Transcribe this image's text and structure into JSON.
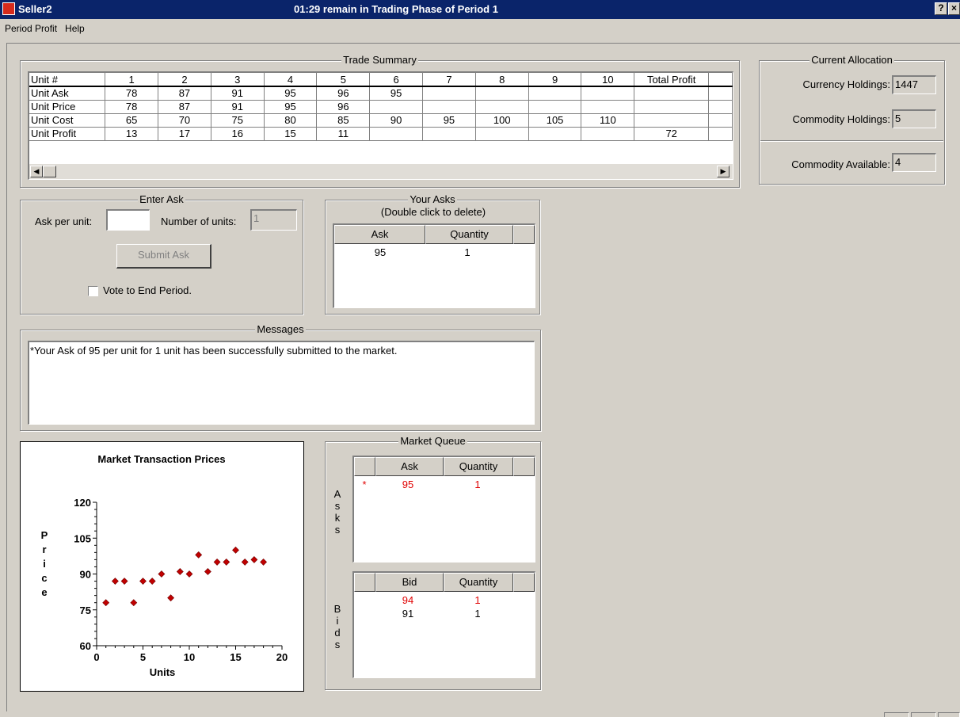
{
  "window": {
    "app_title": "Seller2",
    "caption": "01:29 remain in Trading Phase of Period 1",
    "help_btn": "?",
    "close_btn": "×"
  },
  "menu": [
    "Period Profit",
    "Help"
  ],
  "trade_summary": {
    "title": "Trade Summary",
    "header": [
      "Unit #",
      "1",
      "2",
      "3",
      "4",
      "5",
      "6",
      "7",
      "8",
      "9",
      "10",
      "Total Profit",
      ""
    ],
    "rows": [
      [
        "Unit Ask",
        "78",
        "87",
        "91",
        "95",
        "96",
        "95",
        "",
        "",
        "",
        "",
        "",
        ""
      ],
      [
        "Unit Price",
        "78",
        "87",
        "91",
        "95",
        "96",
        "",
        "",
        "",
        "",
        "",
        "",
        ""
      ],
      [
        "Unit Cost",
        "65",
        "70",
        "75",
        "80",
        "85",
        "90",
        "95",
        "100",
        "105",
        "110",
        "",
        ""
      ],
      [
        "Unit Profit",
        "13",
        "17",
        "16",
        "15",
        "11",
        "",
        "",
        "",
        "",
        "",
        "72",
        ""
      ]
    ]
  },
  "current_allocation": {
    "title": "Current Allocation",
    "currency_label": "Currency Holdings:",
    "currency_value": "1447",
    "commodity_label": "Commodity Holdings:",
    "commodity_value": "5",
    "available_label": "Commodity Available:",
    "available_value": "4"
  },
  "enter_ask": {
    "title": "Enter Ask",
    "ask_label": "Ask per unit:",
    "ask_value": "",
    "units_label": "Number of units:",
    "units_value": "1",
    "submit_label": "Submit Ask",
    "vote_label": "Vote to End Period."
  },
  "your_asks": {
    "title_line1": "Your Asks",
    "title_line2": "(Double click to delete)",
    "col_ask": "Ask",
    "col_qty": "Quantity",
    "rows": [
      {
        "ask": "95",
        "qty": "1"
      }
    ]
  },
  "messages": {
    "title": "Messages",
    "text": "*Your Ask of 95 per unit for 1 unit has been successfully submitted to the market."
  },
  "market_queue": {
    "title": "Market Queue",
    "asks_vertical": "Asks",
    "bids_vertical": "Bids",
    "col_ask": "Ask",
    "col_bid": "Bid",
    "col_qty": "Quantity",
    "asks": [
      {
        "mark": "*",
        "price": "95",
        "qty": "1",
        "own": true
      }
    ],
    "bids": [
      {
        "price": "94",
        "qty": "1",
        "highlight": true
      },
      {
        "price": "91",
        "qty": "1",
        "highlight": false
      }
    ]
  },
  "chart_data": {
    "type": "scatter",
    "title": "Market Transaction Prices",
    "xlabel": "Units",
    "ylabel": "Price",
    "xlim": [
      0,
      20
    ],
    "ylim": [
      60,
      120
    ],
    "xticks": [
      "0",
      "5",
      "10",
      "15",
      "20"
    ],
    "yticks": [
      "60",
      "75",
      "90",
      "105",
      "120"
    ],
    "marker_color": "#c00000",
    "x": [
      1,
      2,
      3,
      4,
      5,
      6,
      7,
      8,
      9,
      10,
      11,
      12,
      13,
      14,
      15,
      16,
      17,
      18
    ],
    "y": [
      78,
      87,
      87,
      78,
      87,
      87,
      90,
      80,
      91,
      90,
      98,
      91,
      95,
      95,
      100,
      95,
      96,
      95
    ]
  }
}
